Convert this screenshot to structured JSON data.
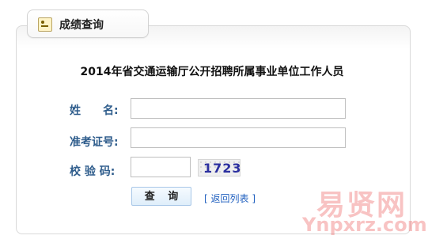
{
  "tab": {
    "title": "成绩查询",
    "icon": "id-card-icon"
  },
  "page_title": "2014年省交通运输厅公开招聘所属事业单位工作人员",
  "form": {
    "name_label": "姓　　名:",
    "id_label": "准考证号:",
    "captcha_label": "校 验 码:",
    "name_value": "",
    "id_value": "",
    "captcha_value": "",
    "captcha_text": "1723"
  },
  "actions": {
    "search_label": "查 询",
    "back_label": "返回列表",
    "bracket_open": "[",
    "bracket_close": "]"
  },
  "watermark": {
    "line1": "易贤网",
    "line2": "Ynpxrz.com"
  }
}
